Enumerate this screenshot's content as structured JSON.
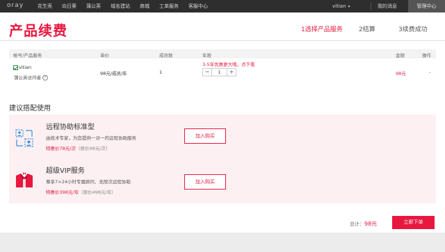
{
  "topbar": {
    "logo": "oray",
    "nav": [
      "花生壳",
      "向日葵",
      "蒲公英",
      "域名建站",
      "商城",
      "工单服务",
      "客服中心"
    ],
    "user": "vitian",
    "my_messages": "我的消息",
    "admin_center": "管理中心"
  },
  "page": {
    "title": "产品续费",
    "steps": [
      "1选择产品服务",
      "2结算",
      "3续费成功"
    ]
  },
  "table": {
    "headers": [
      "帐号/产品服务",
      "单价",
      "成员数",
      "年限",
      "金额",
      "操作"
    ],
    "row": {
      "account": "vitian",
      "role": "蒲公英访问者",
      "help_icon_text": "?",
      "unit_price": "98元/成员/年",
      "members": "1",
      "promo": "3-5年优惠更大哦，点下看",
      "years": "1",
      "minus": "−",
      "plus": "+",
      "amount": "98元",
      "action": "-"
    }
  },
  "suggest": {
    "heading": "建议搭配使用",
    "products": [
      {
        "icon": "remote-assist-icon",
        "title": "远程协助标准型",
        "desc": "由技术专家，为您提供一对一的远程协助服务",
        "price": "特惠价78元/次",
        "orig": "（原价98元/次）",
        "button": "加入购买"
      },
      {
        "icon": "vip-service-icon",
        "title": "超级VIP服务",
        "desc": "尊享7×24小时专属顾问、无限次远程协助",
        "price": "特惠价398元/年",
        "orig": "（原价498元/年）",
        "button": "加入购买"
      }
    ]
  },
  "footer": {
    "total_label": "总计：",
    "total_value": "98元",
    "order_button": "立即下单"
  },
  "colors": {
    "accent": "#e8173f",
    "topbar": "#2e2e2e",
    "panel": "#fcf0f3"
  }
}
